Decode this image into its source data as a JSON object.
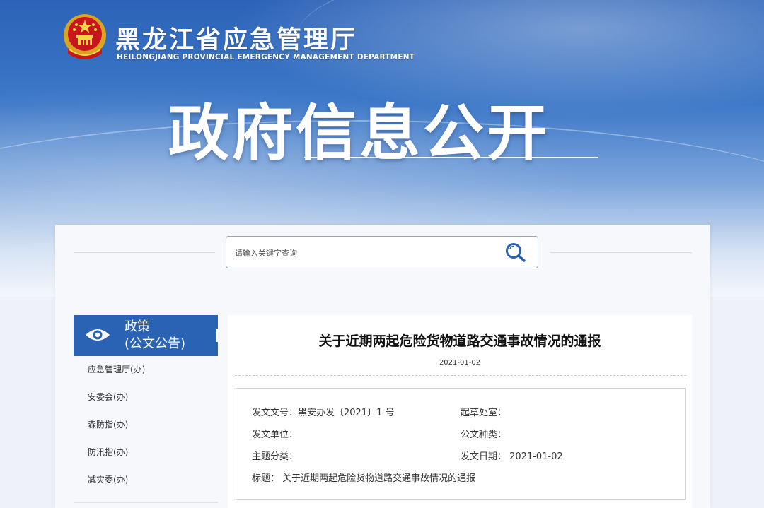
{
  "header": {
    "site_name": "黑龙江省应急管理厅",
    "site_name_en": "HEILONGJIANG PROVINCIAL EMERGENCY MANAGEMENT DEPARTMENT",
    "banner_title": "政府信息公开"
  },
  "search": {
    "placeholder": "请输入关键字查询",
    "value": ""
  },
  "sidebar": {
    "header_line1": "政策",
    "header_line2": "(公文公告)",
    "header_icon": "eye-icon",
    "items": [
      {
        "label": "应急管理厅(办)"
      },
      {
        "label": "安委会(办)"
      },
      {
        "label": "森防指(办)"
      },
      {
        "label": "防汛指(办)"
      },
      {
        "label": "减灾委(办)"
      }
    ]
  },
  "document": {
    "title": "关于近期两起危险货物道路交通事故情况的通报",
    "date": "2021-01-02",
    "meta": {
      "doc_number_label": "发文文号：",
      "doc_number": "黑安办发〔2021〕1 号",
      "drafting_office_label": "起草处室：",
      "drafting_office": "",
      "issuing_unit_label": "发文单位：",
      "issuing_unit": "",
      "doc_type_label": "公文种类：",
      "doc_type": "",
      "subject_label": "主题分类：",
      "subject": "",
      "issue_date_label": "发文日期：",
      "issue_date": "2021-01-02",
      "title_label": "标题：",
      "title_value": "关于近期两起危险货物道路交通事故情况的通报"
    }
  },
  "colors": {
    "banner_blue": "#2c63b8",
    "sidebar_header": "#2b63b4",
    "search_icon": "#2b63b4"
  }
}
